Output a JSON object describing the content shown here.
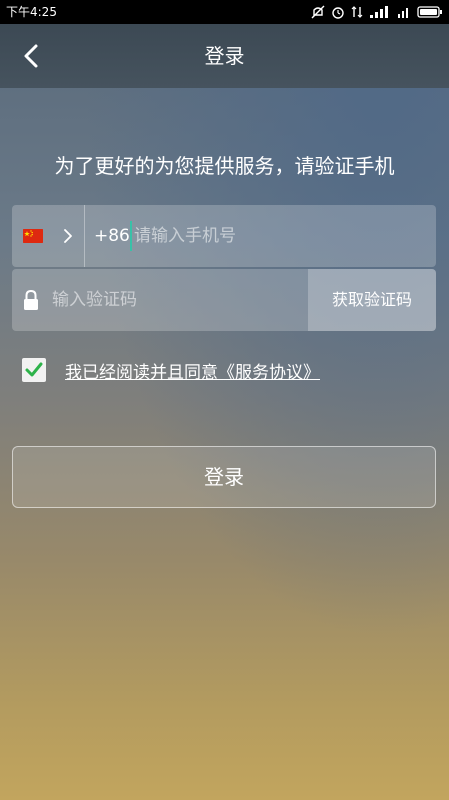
{
  "status_bar": {
    "time": "下午4:25"
  },
  "header": {
    "title": "登录",
    "back_icon": "chevron-left-icon"
  },
  "prompt": "为了更好的为您提供服务，请验证手机",
  "phone": {
    "flag_icon": "china-flag-icon",
    "country_code": "+86",
    "placeholder": "请输入手机号"
  },
  "code": {
    "lock_icon": "lock-icon",
    "placeholder": "输入验证码",
    "get_code_label": "获取验证码"
  },
  "agreement": {
    "checked": true,
    "text": "我已经阅读并且同意《服务协议》"
  },
  "login_button": "登录",
  "colors": {
    "header": "#46535e",
    "check_green": "#2db34a",
    "cursor_accent": "#39c1a8",
    "flag_red": "#de2910",
    "flag_star": "#ffde00"
  }
}
